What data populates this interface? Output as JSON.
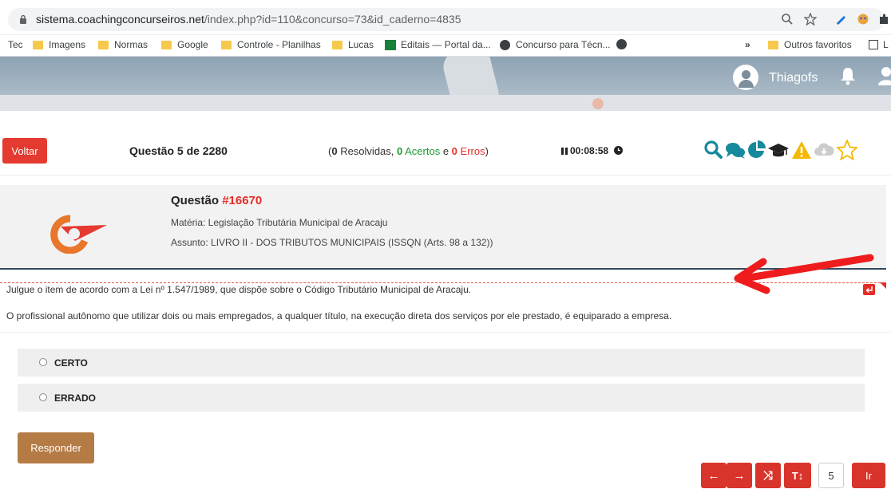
{
  "browser": {
    "url_host": "sistema.coachingconcurseiros.net",
    "url_path": "/index.php?id=110&concurso=73&id_caderno=4835",
    "bookmarks": [
      {
        "label": "Tec",
        "icon": "none"
      },
      {
        "label": "Imagens",
        "icon": "folder-icon"
      },
      {
        "label": "Normas",
        "icon": "folder-icon"
      },
      {
        "label": "Google",
        "icon": "folder-icon"
      },
      {
        "label": "Controle - Planilhas",
        "icon": "folder-icon"
      },
      {
        "label": "Lucas",
        "icon": "folder-icon"
      },
      {
        "label": "Editais — Portal da...",
        "icon": "editais-icon"
      },
      {
        "label": "Concurso para Técn...",
        "icon": "globe-icon"
      }
    ],
    "overflow": "»",
    "other_favorites": "Outros favoritos",
    "reading_list": "L"
  },
  "header": {
    "username": "Thiagofs"
  },
  "toolbar": {
    "back_label": "Voltar",
    "question_counter": "Questão 5 de 2280",
    "stats": {
      "open": "(",
      "resolved_count": "0",
      "resolved_label": " Resolvidas, ",
      "correct_count": "0",
      "correct_label": " Acertos",
      "and": " e ",
      "error_count": "0",
      "error_label": " Erros",
      "close": ")"
    },
    "timer": "00:08:58",
    "icons": [
      "search-icon",
      "comments-icon",
      "statistics-icon",
      "graduation-cap-icon",
      "warning-icon",
      "cloud-download-icon",
      "star-icon"
    ],
    "colors": {
      "teal": "#17899c",
      "warning": "#f5b800",
      "download": "#cccccc",
      "star": "#f5b800"
    }
  },
  "question": {
    "title_prefix": "Questão ",
    "number": "#16670",
    "materia": "Matéria: Legislação Tributária Municipal de Aracaju",
    "assunto": "Assunto: LIVRO II - DOS TRIBUTOS MUNICIPAIS (ISSQN (Arts. 98 a 132))",
    "statement": "Julgue o item de acordo com a Lei nº 1.547/1989, que dispõe sobre o Código Tributário Municipal de Aracaju.",
    "body": "O profissional autônomo que utilizar dois ou mais empregados, a qualquer título, na execução direta dos serviços por ele prestado, é equiparado a empresa."
  },
  "options": [
    {
      "label": "CERTO"
    },
    {
      "label": "ERRADO"
    }
  ],
  "actions": {
    "respond_label": "Responder",
    "prev": "←",
    "next": "→",
    "shuffle": "⤨",
    "font_size": "T↕",
    "page_value": "5",
    "go_label": "Ir"
  },
  "colors": {
    "primary_red": "#d9342b",
    "respond_brown": "#b57b45",
    "question_number": "#e52d27",
    "header_border": "#34495e"
  }
}
